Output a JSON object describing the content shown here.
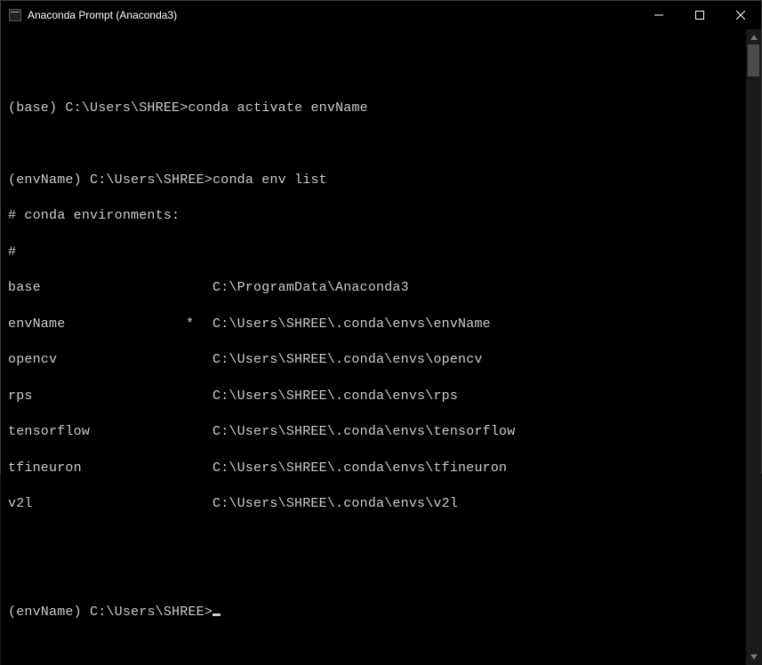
{
  "titlebar": {
    "title": "Anaconda Prompt (Anaconda3)"
  },
  "session": {
    "line1": {
      "prompt_env": "(base)",
      "prompt_path": "C:\\Users\\SHREE>",
      "command": "conda activate envName"
    },
    "line2": {
      "prompt_env": "(envName)",
      "prompt_path": "C:\\Users\\SHREE>",
      "command": "conda env list"
    },
    "header1": "# conda environments:",
    "header2": "#",
    "envs": [
      {
        "name": "base",
        "active": " ",
        "path": "C:\\ProgramData\\Anaconda3"
      },
      {
        "name": "envName",
        "active": "*",
        "path": "C:\\Users\\SHREE\\.conda\\envs\\envName"
      },
      {
        "name": "opencv",
        "active": " ",
        "path": "C:\\Users\\SHREE\\.conda\\envs\\opencv"
      },
      {
        "name": "rps",
        "active": " ",
        "path": "C:\\Users\\SHREE\\.conda\\envs\\rps"
      },
      {
        "name": "tensorflow",
        "active": " ",
        "path": "C:\\Users\\SHREE\\.conda\\envs\\tensorflow"
      },
      {
        "name": "tfineuron",
        "active": " ",
        "path": "C:\\Users\\SHREE\\.conda\\envs\\tfineuron"
      },
      {
        "name": "v2l",
        "active": " ",
        "path": "C:\\Users\\SHREE\\.conda\\envs\\v2l"
      }
    ],
    "line3": {
      "prompt_env": "(envName)",
      "prompt_path": "C:\\Users\\SHREE>"
    }
  }
}
